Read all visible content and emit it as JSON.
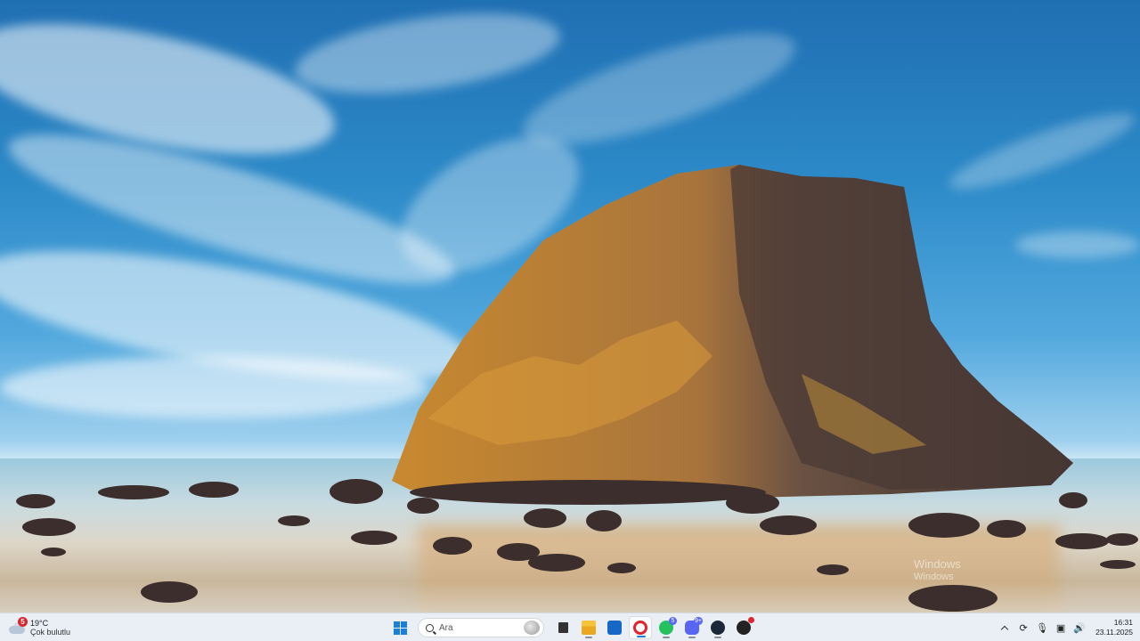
{
  "desktop": {
    "wallpaper": "coastal-rock-sunset",
    "watermark": {
      "title": "Windows",
      "subtitle": "Windows"
    }
  },
  "taskbar": {
    "weather": {
      "temperature": "19°C",
      "condition": "Çok bulutlu",
      "badge": "5"
    },
    "search": {
      "placeholder": "Ara"
    },
    "apps": [
      {
        "name": "start",
        "icon": "windows-logo-icon"
      },
      {
        "name": "task-view",
        "icon": "task-view-icon"
      },
      {
        "name": "file-explorer",
        "icon": "folder-icon"
      },
      {
        "name": "outlook",
        "icon": "outlook-icon"
      },
      {
        "name": "opera",
        "icon": "opera-icon"
      },
      {
        "name": "whatsapp",
        "icon": "whatsapp-icon",
        "badge": "5"
      },
      {
        "name": "discord",
        "icon": "discord-icon",
        "badge": "9+"
      },
      {
        "name": "steam",
        "icon": "steam-icon"
      },
      {
        "name": "ai-app",
        "icon": "app-icon"
      }
    ],
    "tray": {
      "time": "16:31",
      "date": "23.11.2025"
    }
  },
  "colors": {
    "accent": "#1a7fd8",
    "taskbar_bg": "#eef2f7"
  }
}
